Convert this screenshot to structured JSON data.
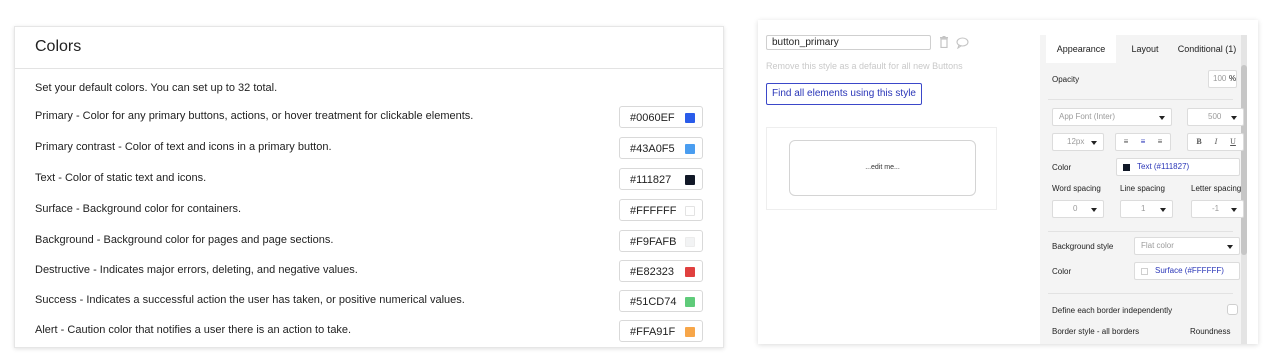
{
  "colors_panel": {
    "title": "Colors",
    "description": "Set your default colors. You can set up to 32 total.",
    "rows": [
      {
        "label": "Primary - Color for any primary buttons, actions, or hover treatment for clickable elements.",
        "hex": "#0060EF",
        "swatch": "#2a5cea"
      },
      {
        "label": "Primary contrast - Color of text and icons in a primary button.",
        "hex": "#43A0F5",
        "swatch": "#4a9df0"
      },
      {
        "label": "Text - Color of static text and icons.",
        "hex": "#111827",
        "swatch": "#111827"
      },
      {
        "label": "Surface - Background color for containers.",
        "hex": "#FFFFFF",
        "swatch": "#ffffff"
      },
      {
        "label": "Background - Background color for pages and page sections.",
        "hex": "#F9FAFB",
        "swatch": "#f2f3f4"
      },
      {
        "label": "Destructive - Indicates major errors, deleting, and negative values.",
        "hex": "#E82323",
        "swatch": "#e0403f"
      },
      {
        "label": "Success - Indicates a successful action the user has taken, or positive numerical values.",
        "hex": "#51CD74",
        "swatch": "#5fcb7a"
      },
      {
        "label": "Alert - Caution color that notifies a user there is an action to take.",
        "hex": "#FFA91F",
        "swatch": "#f7a649"
      }
    ]
  },
  "editor": {
    "style_name": "button_primary",
    "remove_default_text": "Remove this style as a default for all new Buttons",
    "find_all_label": "Find all elements using this style",
    "preview_text": "...edit me...",
    "tabs": [
      "Appearance",
      "Layout",
      "Conditional (1)"
    ],
    "opacity_label": "Opacity",
    "opacity_value": "100",
    "opacity_unit": "%",
    "font_family": "App Font (Inter)",
    "font_weight": "500",
    "font_size": "12px",
    "align_buttons": [
      "≡",
      "≡",
      "≡"
    ],
    "style_buttons": [
      "B",
      "I",
      "U"
    ],
    "color_label": "Color",
    "text_color_value": "Text (#111827)",
    "word_spacing_label": "Word spacing",
    "line_spacing_label": "Line spacing",
    "letter_spacing_label": "Letter spacing",
    "word_spacing_value": "0",
    "line_spacing_value": "1",
    "letter_spacing_value": "-1",
    "background_style_label": "Background style",
    "background_style_value": "Flat color",
    "bg_color_label": "Color",
    "bg_color_value": "Surface (#FFFFFF)",
    "border_independent_label": "Define each border independently",
    "border_style_label": "Border style - all borders",
    "roundness_label": "Roundness",
    "accent_color": "#2a36b8"
  }
}
